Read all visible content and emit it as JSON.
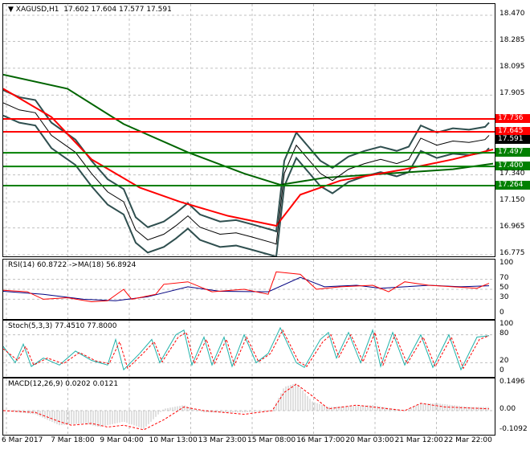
{
  "header": {
    "symbol": "XAGUSD,H1",
    "ohlc": "17.602 17.604 17.577 17.591"
  },
  "price_axis": [
    "18.470",
    "18.285",
    "18.095",
    "17.905",
    "17.340",
    "17.150",
    "16.965",
    "16.775"
  ],
  "levels": [
    {
      "label": "17.736",
      "value": 17.736,
      "color": "#ff0000"
    },
    {
      "label": "17.645",
      "value": 17.645,
      "color": "#ff0000"
    },
    {
      "label": "17.497",
      "value": 17.497,
      "color": "#008000"
    },
    {
      "label": "17.400",
      "value": 17.4,
      "color": "#008000"
    },
    {
      "label": "17.264",
      "value": 17.264,
      "color": "#008000"
    }
  ],
  "current_price": {
    "label": "17.591",
    "value": 17.591
  },
  "price": [
    [
      0,
      17.85
    ],
    [
      20,
      17.8
    ],
    [
      40,
      17.78
    ],
    [
      60,
      17.62
    ],
    [
      90,
      17.5
    ],
    [
      110,
      17.35
    ],
    [
      130,
      17.22
    ],
    [
      150,
      17.15
    ],
    [
      165,
      16.95
    ],
    [
      180,
      16.88
    ],
    [
      200,
      16.92
    ],
    [
      215,
      16.98
    ],
    [
      230,
      17.05
    ],
    [
      245,
      16.97
    ],
    [
      270,
      16.92
    ],
    [
      290,
      16.93
    ],
    [
      310,
      16.9
    ],
    [
      335,
      16.86
    ],
    [
      340,
      16.85
    ],
    [
      350,
      17.35
    ],
    [
      365,
      17.55
    ],
    [
      380,
      17.45
    ],
    [
      395,
      17.35
    ],
    [
      410,
      17.3
    ],
    [
      430,
      17.38
    ],
    [
      450,
      17.42
    ],
    [
      470,
      17.45
    ],
    [
      490,
      17.42
    ],
    [
      505,
      17.45
    ],
    [
      520,
      17.6
    ],
    [
      540,
      17.55
    ],
    [
      560,
      17.58
    ],
    [
      580,
      17.57
    ],
    [
      600,
      17.59
    ],
    [
      605,
      17.62
    ]
  ],
  "ma_red": [
    [
      0,
      17.95
    ],
    [
      60,
      17.75
    ],
    [
      110,
      17.45
    ],
    [
      170,
      17.25
    ],
    [
      220,
      17.15
    ],
    [
      280,
      17.05
    ],
    [
      340,
      16.98
    ],
    [
      370,
      17.2
    ],
    [
      420,
      17.3
    ],
    [
      500,
      17.38
    ],
    [
      560,
      17.45
    ],
    [
      610,
      17.52
    ]
  ],
  "ma_green": [
    [
      0,
      18.05
    ],
    [
      80,
      17.95
    ],
    [
      150,
      17.7
    ],
    [
      230,
      17.5
    ],
    [
      300,
      17.35
    ],
    [
      345,
      17.27
    ],
    [
      400,
      17.32
    ],
    [
      480,
      17.35
    ],
    [
      560,
      17.38
    ],
    [
      610,
      17.42
    ]
  ],
  "rsi": {
    "title": "RSI(14) 60.8722  ->MA(18) 56.8924",
    "axis": [
      "100",
      "70",
      "50",
      "30",
      "0"
    ],
    "rsi": [
      [
        0,
        48
      ],
      [
        30,
        45
      ],
      [
        50,
        30
      ],
      [
        80,
        33
      ],
      [
        110,
        25
      ],
      [
        130,
        27
      ],
      [
        150,
        50
      ],
      [
        160,
        30
      ],
      [
        190,
        40
      ],
      [
        200,
        60
      ],
      [
        230,
        65
      ],
      [
        260,
        45
      ],
      [
        300,
        50
      ],
      [
        330,
        40
      ],
      [
        340,
        85
      ],
      [
        370,
        80
      ],
      [
        390,
        50
      ],
      [
        420,
        55
      ],
      [
        460,
        58
      ],
      [
        480,
        45
      ],
      [
        500,
        65
      ],
      [
        530,
        58
      ],
      [
        560,
        55
      ],
      [
        590,
        52
      ],
      [
        605,
        62
      ]
    ],
    "ma": [
      [
        0,
        46
      ],
      [
        50,
        40
      ],
      [
        100,
        30
      ],
      [
        140,
        27
      ],
      [
        180,
        35
      ],
      [
        230,
        55
      ],
      [
        270,
        46
      ],
      [
        330,
        45
      ],
      [
        370,
        74
      ],
      [
        400,
        55
      ],
      [
        440,
        58
      ],
      [
        470,
        52
      ],
      [
        500,
        55
      ],
      [
        530,
        58
      ],
      [
        570,
        55
      ],
      [
        605,
        57
      ]
    ]
  },
  "stoch": {
    "title": "Stoch(5,3,3) 77.4510 77.8000",
    "axis": [
      "100",
      "80",
      "20",
      "0"
    ],
    "k": [
      [
        0,
        55
      ],
      [
        15,
        20
      ],
      [
        25,
        60
      ],
      [
        35,
        12
      ],
      [
        50,
        30
      ],
      [
        70,
        15
      ],
      [
        90,
        45
      ],
      [
        110,
        25
      ],
      [
        130,
        15
      ],
      [
        140,
        70
      ],
      [
        150,
        5
      ],
      [
        170,
        40
      ],
      [
        185,
        70
      ],
      [
        195,
        20
      ],
      [
        215,
        80
      ],
      [
        225,
        90
      ],
      [
        235,
        15
      ],
      [
        250,
        75
      ],
      [
        260,
        15
      ],
      [
        275,
        75
      ],
      [
        285,
        12
      ],
      [
        300,
        80
      ],
      [
        315,
        20
      ],
      [
        330,
        40
      ],
      [
        345,
        95
      ],
      [
        365,
        20
      ],
      [
        375,
        10
      ],
      [
        395,
        70
      ],
      [
        405,
        85
      ],
      [
        415,
        30
      ],
      [
        430,
        85
      ],
      [
        445,
        20
      ],
      [
        460,
        90
      ],
      [
        470,
        12
      ],
      [
        485,
        85
      ],
      [
        500,
        15
      ],
      [
        520,
        80
      ],
      [
        535,
        10
      ],
      [
        555,
        80
      ],
      [
        570,
        5
      ],
      [
        590,
        75
      ],
      [
        605,
        78
      ]
    ],
    "d": [
      [
        0,
        50
      ],
      [
        18,
        25
      ],
      [
        28,
        55
      ],
      [
        38,
        15
      ],
      [
        55,
        30
      ],
      [
        75,
        18
      ],
      [
        95,
        42
      ],
      [
        115,
        24
      ],
      [
        132,
        18
      ],
      [
        145,
        65
      ],
      [
        155,
        8
      ],
      [
        173,
        38
      ],
      [
        188,
        65
      ],
      [
        198,
        22
      ],
      [
        218,
        75
      ],
      [
        228,
        85
      ],
      [
        238,
        18
      ],
      [
        253,
        70
      ],
      [
        263,
        18
      ],
      [
        278,
        70
      ],
      [
        288,
        15
      ],
      [
        303,
        75
      ],
      [
        318,
        22
      ],
      [
        333,
        40
      ],
      [
        348,
        90
      ],
      [
        368,
        22
      ],
      [
        378,
        12
      ],
      [
        398,
        65
      ],
      [
        408,
        80
      ],
      [
        418,
        32
      ],
      [
        433,
        80
      ],
      [
        448,
        22
      ],
      [
        463,
        85
      ],
      [
        473,
        15
      ],
      [
        488,
        80
      ],
      [
        503,
        18
      ],
      [
        523,
        75
      ],
      [
        538,
        12
      ],
      [
        558,
        75
      ],
      [
        573,
        8
      ],
      [
        593,
        70
      ],
      [
        605,
        78
      ]
    ]
  },
  "macd": {
    "title": "MACD(12,26,9) 0.0202 0.0121",
    "axis": [
      "0.1496",
      "0.00",
      "-0.1092"
    ],
    "hist": [
      [
        0,
        0
      ],
      [
        40,
        -0.02
      ],
      [
        70,
        -0.08
      ],
      [
        100,
        -0.07
      ],
      [
        120,
        -0.09
      ],
      [
        150,
        -0.06
      ],
      [
        175,
        -0.1
      ],
      [
        200,
        0.01
      ],
      [
        225,
        0.03
      ],
      [
        250,
        -0.01
      ],
      [
        300,
        -0.01
      ],
      [
        335,
        0
      ],
      [
        350,
        0.13
      ],
      [
        365,
        0.15
      ],
      [
        385,
        0.05
      ],
      [
        405,
        0.02
      ],
      [
        460,
        0.03
      ],
      [
        500,
        0
      ],
      [
        520,
        0.04
      ],
      [
        540,
        0.04
      ],
      [
        580,
        0.02
      ],
      [
        605,
        0.02
      ]
    ],
    "signal": [
      [
        0,
        0
      ],
      [
        40,
        -0.01
      ],
      [
        70,
        -0.06
      ],
      [
        85,
        -0.08
      ],
      [
        110,
        -0.07
      ],
      [
        130,
        -0.09
      ],
      [
        150,
        -0.08
      ],
      [
        175,
        -0.105
      ],
      [
        200,
        -0.05
      ],
      [
        225,
        0.02
      ],
      [
        250,
        0
      ],
      [
        300,
        -0.02
      ],
      [
        335,
        0
      ],
      [
        350,
        0.1
      ],
      [
        365,
        0.145
      ],
      [
        385,
        0.08
      ],
      [
        405,
        0.01
      ],
      [
        440,
        0.03
      ],
      [
        500,
        0
      ],
      [
        520,
        0.04
      ],
      [
        550,
        0.02
      ],
      [
        605,
        0.01
      ]
    ]
  },
  "time_axis": [
    "6 Mar 2017",
    "7 Mar 18:00",
    "9 Mar 04:00",
    "10 Mar 13:00",
    "13 Mar 23:00",
    "15 Mar 08:00",
    "16 Mar 17:00",
    "20 Mar 03:00",
    "21 Mar 12:00",
    "22 Mar 22:00"
  ]
}
